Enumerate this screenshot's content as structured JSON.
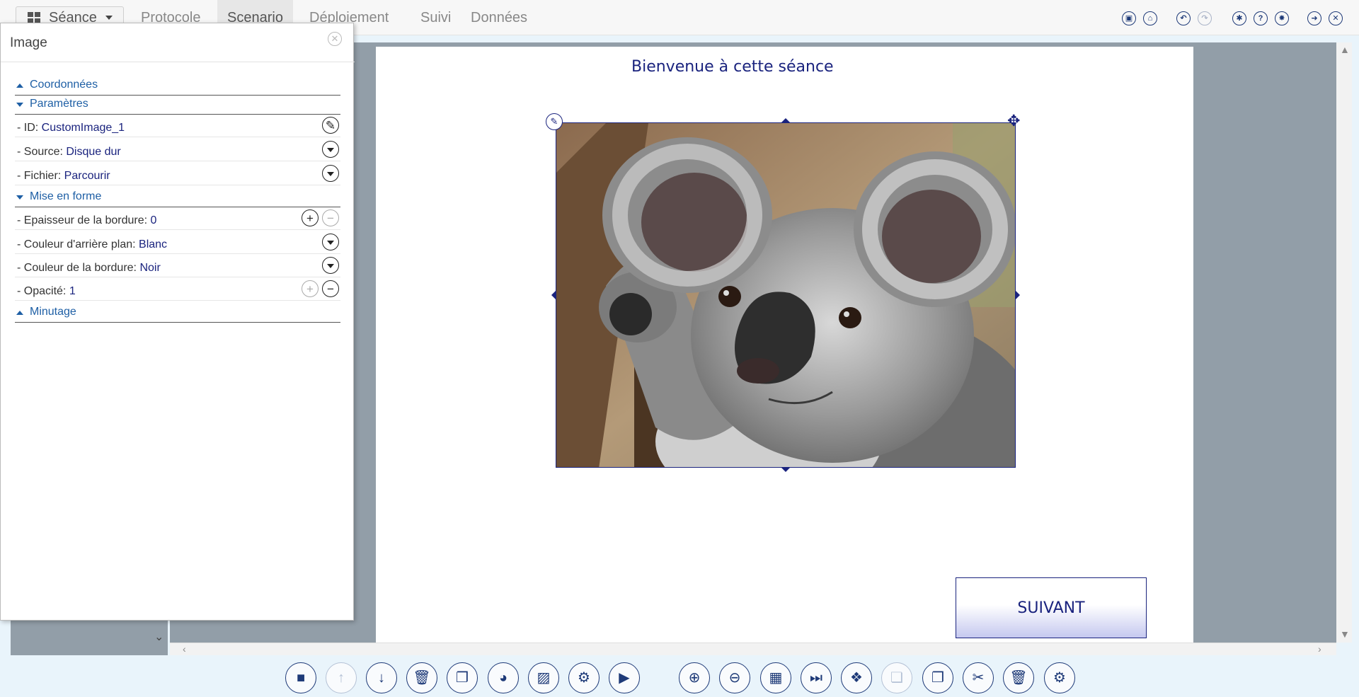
{
  "nav": {
    "seance_label": "Séance",
    "tabs": [
      "Protocole",
      "Scenario",
      "Déploiement",
      "Suivi",
      "Données"
    ],
    "active_tab": "Scenario"
  },
  "top_icons": [
    {
      "name": "save-icon",
      "glyph": "▣"
    },
    {
      "name": "unlock-icon",
      "glyph": "⌂"
    },
    {
      "name": "undo-icon",
      "glyph": "↶"
    },
    {
      "name": "redo-icon",
      "glyph": "↷"
    },
    {
      "name": "settings-share-icon",
      "glyph": "✱"
    },
    {
      "name": "help-icon",
      "glyph": "?"
    },
    {
      "name": "bug-icon",
      "glyph": "✸"
    },
    {
      "name": "logout-icon",
      "glyph": "➜"
    },
    {
      "name": "close-window-icon",
      "glyph": "✕"
    }
  ],
  "panel": {
    "title": "Image",
    "sections": {
      "coordonnees": "Coordonnées",
      "parametres": "Paramètres",
      "mise_en_forme": "Mise en forme",
      "minutage": "Minutage"
    },
    "rows": {
      "id": {
        "label": "- ID: ",
        "value": "CustomImage_1"
      },
      "source": {
        "label": "- Source: ",
        "value": "Disque dur"
      },
      "fichier": {
        "label": "- Fichier: ",
        "value": "Parcourir"
      },
      "epaisseur": {
        "label": "- Epaisseur de la bordure: ",
        "value": "0"
      },
      "fond": {
        "label": "- Couleur d'arrière plan: ",
        "value": "Blanc"
      },
      "bordure": {
        "label": "- Couleur de la bordure: ",
        "value": "Noir"
      },
      "opacite": {
        "label": "- Opacité: ",
        "value": "1"
      }
    }
  },
  "slide": {
    "title": "Bienvenue à cette séance",
    "next_button": "SUIVANT",
    "image_subject": "koala"
  },
  "colors": {
    "accent": "#1a237e",
    "link": "#1e5fa5",
    "workspace": "#929ea8"
  }
}
